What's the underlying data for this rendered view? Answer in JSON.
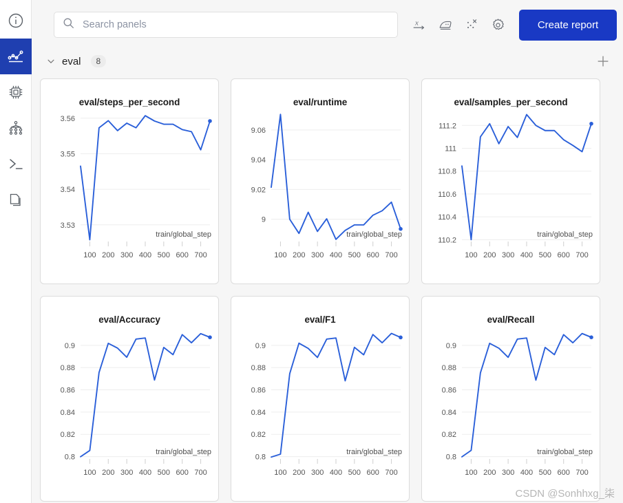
{
  "sidebar": {
    "items": [
      {
        "name": "info",
        "icon": "info-circle-icon",
        "active": false
      },
      {
        "name": "charts",
        "icon": "line-chart-icon",
        "active": true
      },
      {
        "name": "system",
        "icon": "cpu-chip-icon",
        "active": false
      },
      {
        "name": "model-graph",
        "icon": "node-graph-icon",
        "active": false
      },
      {
        "name": "logs",
        "icon": "terminal-icon",
        "active": false
      },
      {
        "name": "files",
        "icon": "files-icon",
        "active": false
      }
    ]
  },
  "toolbar": {
    "search_placeholder": "Search panels",
    "search_value": "",
    "search_icon": "search-icon",
    "icons": [
      {
        "name": "x-axis-icon",
        "label": "x-axis"
      },
      {
        "name": "smoothing-iron-icon",
        "label": "smoothing"
      },
      {
        "name": "outliers-icon",
        "label": "outliers"
      },
      {
        "name": "gear-icon",
        "label": "settings"
      }
    ],
    "create_report_label": "Create report"
  },
  "section": {
    "chevron_icon": "chevron-down-icon",
    "title": "eval",
    "count": "8",
    "add_icon": "plus-icon"
  },
  "watermark": "CSDN @Sonhhxg_柒",
  "colors": {
    "line": "#2a5fd9",
    "accent": "#1939c4",
    "rail_active": "#1f3fb0",
    "grid": "#ededed",
    "panel_bg": "#ffffff",
    "page_bg": "#f6f6f6",
    "axis_text": "#555555"
  },
  "chart_data": [
    {
      "type": "line",
      "title": "eval/steps_per_second",
      "xlabel": "train/global_step",
      "ylabel": "",
      "xlim": [
        50,
        750
      ],
      "ylim": [
        3.5255,
        3.5615
      ],
      "xticks": [
        100,
        200,
        300,
        400,
        500,
        600,
        700
      ],
      "yticks": [
        3.53,
        3.54,
        3.55,
        3.56
      ],
      "ytick_labels": [
        "3.53",
        "3.54",
        "3.55",
        "3.56"
      ],
      "grid": true,
      "legend": "none",
      "marker_last": true,
      "x": [
        50,
        100,
        150,
        200,
        250,
        300,
        350,
        400,
        450,
        500,
        550,
        600,
        650,
        700,
        750
      ],
      "y": [
        3.5465,
        3.5258,
        3.5573,
        3.5593,
        3.5565,
        3.5586,
        3.5573,
        3.5607,
        3.5592,
        3.5583,
        3.5583,
        3.5568,
        3.5562,
        3.5511,
        3.5592
      ]
    },
    {
      "type": "line",
      "title": "eval/runtime",
      "xlabel": "train/global_step",
      "ylabel": "",
      "xlim": [
        50,
        750
      ],
      "ylim": [
        8.9855,
        9.0715
      ],
      "xticks": [
        100,
        200,
        300,
        400,
        500,
        600,
        700
      ],
      "yticks": [
        9,
        9.02,
        9.04,
        9.06
      ],
      "ytick_labels": [
        "9",
        "9.02",
        "9.04",
        "9.06"
      ],
      "grid": true,
      "legend": "none",
      "marker_last": true,
      "x": [
        50,
        100,
        150,
        200,
        250,
        300,
        350,
        400,
        450,
        500,
        550,
        600,
        650,
        700,
        750
      ],
      "y": [
        9.0215,
        9.0705,
        9.0,
        8.9905,
        9.0047,
        8.9918,
        9.0003,
        8.9865,
        8.9925,
        8.9962,
        8.9962,
        9.0027,
        9.0057,
        9.0115,
        8.9935
      ]
    },
    {
      "type": "line",
      "title": "eval/samples_per_second",
      "xlabel": "train/global_step",
      "ylabel": "",
      "xlim": [
        50,
        750
      ],
      "ylim": [
        110.19,
        111.31
      ],
      "xticks": [
        100,
        200,
        300,
        400,
        500,
        600,
        700
      ],
      "yticks": [
        110.2,
        110.4,
        110.6,
        110.8,
        111,
        111.2
      ],
      "ytick_labels": [
        "110.2",
        "110.4",
        "110.6",
        "110.8",
        "111",
        "111.2"
      ],
      "grid": true,
      "legend": "none",
      "marker_last": true,
      "x": [
        50,
        100,
        150,
        200,
        250,
        300,
        350,
        400,
        450,
        500,
        550,
        600,
        650,
        700,
        750
      ],
      "y": [
        110.845,
        110.2,
        111.1,
        111.215,
        111.04,
        111.19,
        111.095,
        111.295,
        111.2,
        111.155,
        111.155,
        111.075,
        111.025,
        110.97,
        111.215
      ]
    },
    {
      "type": "line",
      "title": "eval/Accuracy",
      "xlabel": "train/global_step",
      "ylabel": "",
      "xlim": [
        50,
        750
      ],
      "ylim": [
        0.7985,
        0.9135
      ],
      "xticks": [
        100,
        200,
        300,
        400,
        500,
        600,
        700
      ],
      "yticks": [
        0.8,
        0.82,
        0.84,
        0.86,
        0.88,
        0.9
      ],
      "ytick_labels": [
        "0.8",
        "0.82",
        "0.84",
        "0.86",
        "0.88",
        "0.9"
      ],
      "grid": true,
      "legend": "none",
      "marker_last": true,
      "x": [
        50,
        100,
        150,
        200,
        250,
        300,
        350,
        400,
        450,
        500,
        550,
        600,
        650,
        700,
        750
      ],
      "y": [
        0.7999,
        0.8055,
        0.8755,
        0.9018,
        0.8975,
        0.8893,
        0.9056,
        0.9066,
        0.8688,
        0.8981,
        0.8916,
        0.9096,
        0.9023,
        0.9105,
        0.9072
      ]
    },
    {
      "type": "line",
      "title": "eval/F1",
      "xlabel": "train/global_step",
      "ylabel": "",
      "xlim": [
        50,
        750
      ],
      "ylim": [
        0.7985,
        0.9135
      ],
      "xticks": [
        100,
        200,
        300,
        400,
        500,
        600,
        700
      ],
      "yticks": [
        0.8,
        0.82,
        0.84,
        0.86,
        0.88,
        0.9
      ],
      "ytick_labels": [
        "0.8",
        "0.82",
        "0.84",
        "0.86",
        "0.88",
        "0.9"
      ],
      "grid": true,
      "legend": "none",
      "marker_last": true,
      "x": [
        50,
        100,
        150,
        200,
        250,
        300,
        350,
        400,
        450,
        500,
        550,
        600,
        650,
        700,
        750
      ],
      "y": [
        0.7996,
        0.8022,
        0.8745,
        0.9019,
        0.8972,
        0.8891,
        0.9056,
        0.9066,
        0.8681,
        0.8982,
        0.8915,
        0.9097,
        0.9023,
        0.9107,
        0.9071
      ]
    },
    {
      "type": "line",
      "title": "eval/Recall",
      "xlabel": "train/global_step",
      "ylabel": "",
      "xlim": [
        50,
        750
      ],
      "ylim": [
        0.7985,
        0.9135
      ],
      "xticks": [
        100,
        200,
        300,
        400,
        500,
        600,
        700
      ],
      "yticks": [
        0.8,
        0.82,
        0.84,
        0.86,
        0.88,
        0.9
      ],
      "ytick_labels": [
        "0.8",
        "0.82",
        "0.84",
        "0.86",
        "0.88",
        "0.9"
      ],
      "grid": true,
      "legend": "none",
      "marker_last": true,
      "x": [
        50,
        100,
        150,
        200,
        250,
        300,
        350,
        400,
        450,
        500,
        550,
        600,
        650,
        700,
        750
      ],
      "y": [
        0.7998,
        0.8056,
        0.8752,
        0.9018,
        0.8974,
        0.8892,
        0.9056,
        0.9066,
        0.8687,
        0.8981,
        0.8916,
        0.9096,
        0.9023,
        0.9106,
        0.9072
      ]
    }
  ]
}
